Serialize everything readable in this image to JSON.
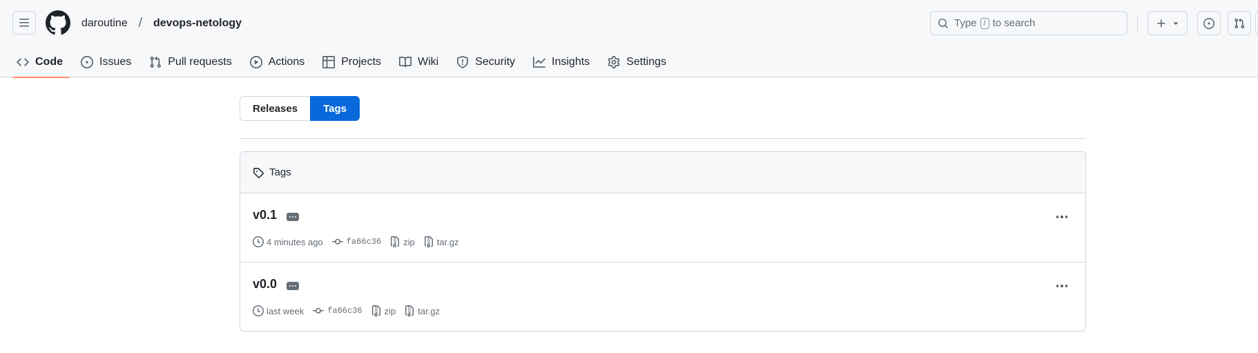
{
  "header": {
    "owner": "daroutine",
    "separator": "/",
    "repo": "devops-netology",
    "search": {
      "prefix": "Type",
      "key": "/",
      "suffix": "to search"
    }
  },
  "nav": {
    "tabs": [
      {
        "label": "Code",
        "icon": "code-icon",
        "active": true
      },
      {
        "label": "Issues",
        "icon": "issue-opened-icon"
      },
      {
        "label": "Pull requests",
        "icon": "git-pull-request-icon"
      },
      {
        "label": "Actions",
        "icon": "play-icon"
      },
      {
        "label": "Projects",
        "icon": "table-icon"
      },
      {
        "label": "Wiki",
        "icon": "book-icon"
      },
      {
        "label": "Security",
        "icon": "shield-icon"
      },
      {
        "label": "Insights",
        "icon": "graph-icon"
      },
      {
        "label": "Settings",
        "icon": "gear-icon"
      }
    ]
  },
  "subnav": {
    "releases": "Releases",
    "tags": "Tags",
    "selected": "tags"
  },
  "tags_box": {
    "header": "Tags",
    "items": [
      {
        "name": "v0.1",
        "time": "4 minutes ago",
        "commit": "fa66c36",
        "zip": "zip",
        "targz": "tar.gz"
      },
      {
        "name": "v0.0",
        "time": "last week",
        "commit": "fa66c36",
        "zip": "zip",
        "targz": "tar.gz"
      }
    ]
  },
  "colors": {
    "accent": "#0969da",
    "tab_underline": "#fd8c73",
    "border": "#d0d7de",
    "muted": "#656d76"
  }
}
